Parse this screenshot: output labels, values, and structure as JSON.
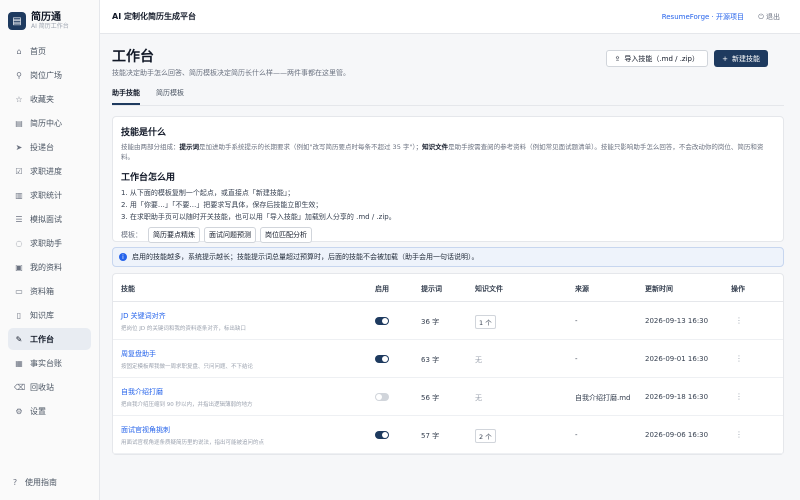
{
  "brand": {
    "name": "简历通",
    "sub": "AI 简历工作台",
    "logo_icon": "document-icon"
  },
  "nav": [
    {
      "label": "首页",
      "icon": "⌂"
    },
    {
      "label": "岗位广场",
      "icon": "⚲"
    },
    {
      "label": "收藏夹",
      "icon": "☆"
    },
    {
      "label": "简历中心",
      "icon": "▤"
    },
    {
      "label": "投递台",
      "icon": "➤"
    },
    {
      "label": "求职进度",
      "icon": "☑"
    },
    {
      "label": "求职统计",
      "icon": "▥"
    },
    {
      "label": "模拟面试",
      "icon": "☰"
    },
    {
      "label": "求职助手",
      "icon": "◌"
    },
    {
      "label": "我的资料",
      "icon": "▣"
    },
    {
      "label": "资料箱",
      "icon": "▭"
    },
    {
      "label": "知识库",
      "icon": "▯"
    },
    {
      "label": "工作台",
      "icon": "✎",
      "active": true
    },
    {
      "label": "事实台账",
      "icon": "▦"
    },
    {
      "label": "回收站",
      "icon": "⌫"
    },
    {
      "label": "设置",
      "icon": "⚙"
    }
  ],
  "help": "使用指南",
  "topbar": {
    "title": "AI 定制化简历生成平台",
    "link": "ResumeForge · 开源项目",
    "logout": "退出"
  },
  "page": {
    "title": "工作台",
    "subtitle": "技能决定助手怎么回答、简历模板决定简历长什么样——两件事都在这里管。",
    "import_btn": "导入技能（.md / .zip）",
    "new_btn": "新建技能"
  },
  "tabs": [
    "助手技能",
    "简历模板"
  ],
  "info": {
    "h1": "技能是什么",
    "p1_a": "技能由两部分组成：",
    "p1_b": "提示词",
    "p1_c": "是加进助手系统提示的长期要求（例如\"改写简历要点时每条不超过 35 字\"）；",
    "p1_d": "知识文件",
    "p1_e": "是助手按需查阅的参考资料（例如常见面试题清单）。技能只影响助手怎么回答，不会改动你的岗位、简历和资料。",
    "h2": "工作台怎么用",
    "steps": [
      "1. 从下面的模板复制一个起点，或直接点「新建技能」；",
      "2. 用「你要…」「不要…」把要求写具体，保存后技能立即生效；",
      "3. 在求职助手页可以随时开关技能，也可以用「导入技能」加载别人分享的 .md / .zip。"
    ],
    "tpl_label": "模板：",
    "templates": [
      "简历要点精炼",
      "面试问题预测",
      "岗位匹配分析"
    ]
  },
  "notice": "启用的技能越多，系统提示越长；技能提示词总量超过预算时，后面的技能不会被加载（助手会用一句话说明）。",
  "table": {
    "headers": [
      "技能",
      "启用",
      "提示词",
      "知识文件",
      "来源",
      "更新时间",
      "操作"
    ],
    "rows": [
      {
        "name": "JD 关键词对齐",
        "desc": "把岗位 JD 的关键词和我的资料逐条对齐，标出缺口",
        "enabled": true,
        "prompt": "36 字",
        "files": "1 个",
        "source": "-",
        "updated": "2026-09-13 16:30"
      },
      {
        "name": "周复盘助手",
        "desc": "按固定模板帮我做一周求职复盘、只问问题、不下结论",
        "enabled": true,
        "prompt": "63 字",
        "files": "无",
        "source": "-",
        "updated": "2026-09-01 16:30"
      },
      {
        "name": "自我介绍打磨",
        "desc": "把自我介绍压缩到 90 秒以内，并指出逻辑薄弱的地方",
        "enabled": false,
        "prompt": "56 字",
        "files": "无",
        "source": "自我介绍打磨.md",
        "updated": "2026-09-18 16:30"
      },
      {
        "name": "面试官视角挑刺",
        "desc": "用面试官视角逐条质疑简历里的说法，指出可能被追问的点",
        "enabled": true,
        "prompt": "57 字",
        "files": "2 个",
        "source": "-",
        "updated": "2026-09-06 16:30"
      }
    ]
  }
}
